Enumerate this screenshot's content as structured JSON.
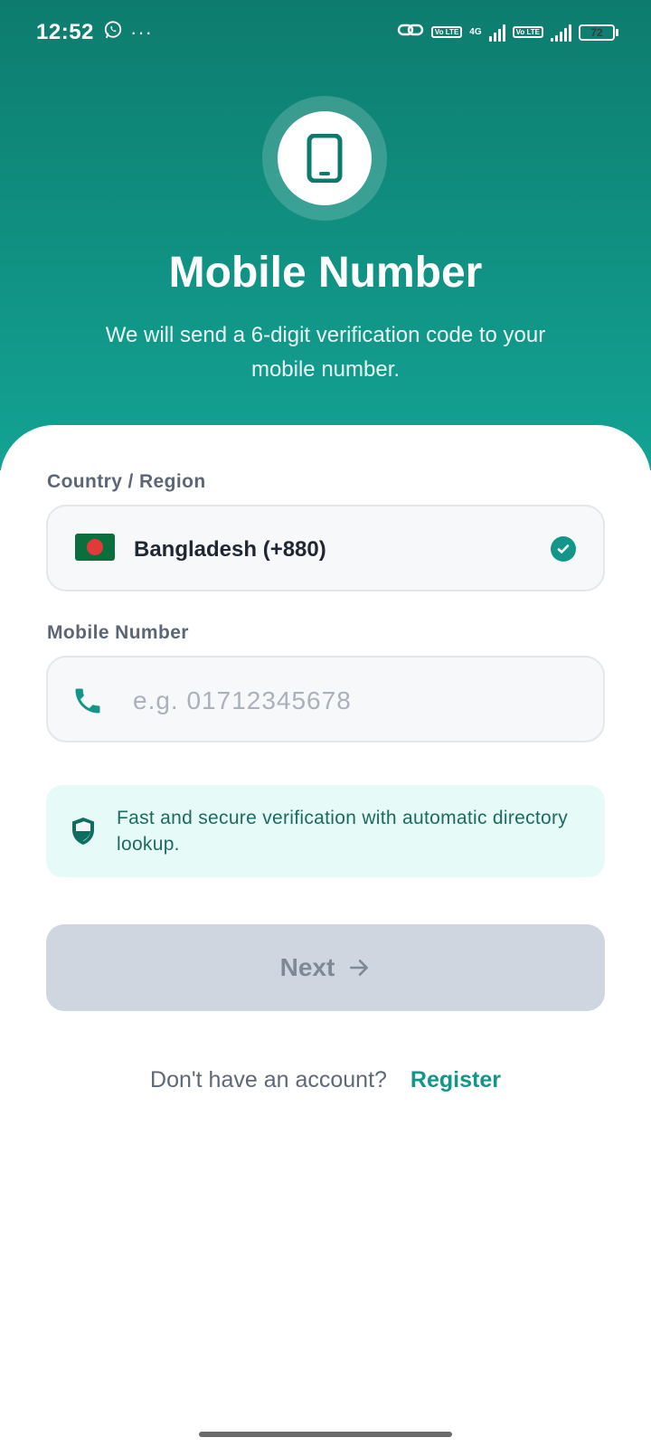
{
  "status_bar": {
    "time": "12:52",
    "dots": "···",
    "network": "4G",
    "volte_label": "Vo LTE",
    "battery": "72",
    "icons": [
      "whatsapp-icon",
      "link-icon",
      "volte-icon",
      "signal-icon",
      "battery-icon"
    ]
  },
  "hero": {
    "icon": "smartphone-icon",
    "title": "Mobile Number",
    "subtitle": "We will send a 6-digit verification code to your mobile number."
  },
  "form": {
    "country_label": "Country / Region",
    "country_value": "Bangladesh (+880)",
    "mobile_label": "Mobile Number",
    "mobile_placeholder": "e.g. 01712345678",
    "mobile_value": ""
  },
  "info": {
    "text": "Fast and secure verification with automatic directory lookup."
  },
  "buttons": {
    "next": "Next"
  },
  "footer": {
    "question": "Don't have an account?",
    "register": "Register"
  },
  "colors": {
    "header_top": "#0d7c6e",
    "header_bottom": "#13a394",
    "accent": "#12968a",
    "button_disabled": "#cfd6e0",
    "info_bg": "#e6fbf7"
  }
}
